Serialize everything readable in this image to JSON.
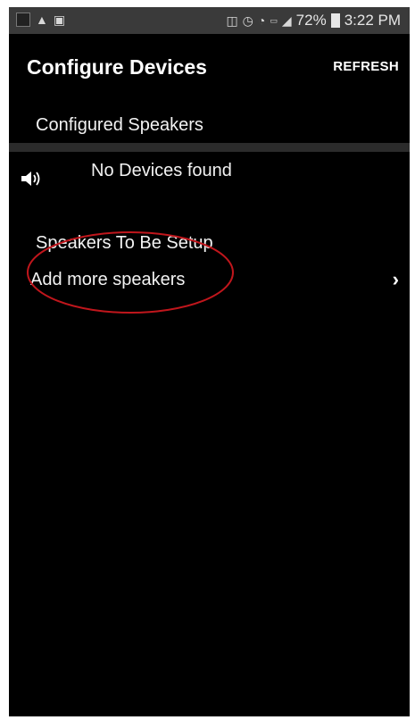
{
  "status_bar": {
    "battery": "72%",
    "time": "3:22 PM",
    "left_icons": [
      "app-thumbnail-icon",
      "warning-icon",
      "clipboard-icon"
    ],
    "right_icons": [
      "nfc-icon",
      "alarm-icon",
      "wifi-icon",
      "volte-icon",
      "signal-icon",
      "battery-icon"
    ]
  },
  "app_bar": {
    "title": "Configure Devices",
    "refresh_label": "REFRESH"
  },
  "configured": {
    "header": "Configured Speakers",
    "empty_text": "No Devices found",
    "icon": "speaker-icon"
  },
  "to_setup": {
    "header": "Speakers To Be Setup",
    "add_label": "Add more speakers",
    "chevron": "›"
  },
  "annotation": {
    "color": "#c0161c"
  }
}
